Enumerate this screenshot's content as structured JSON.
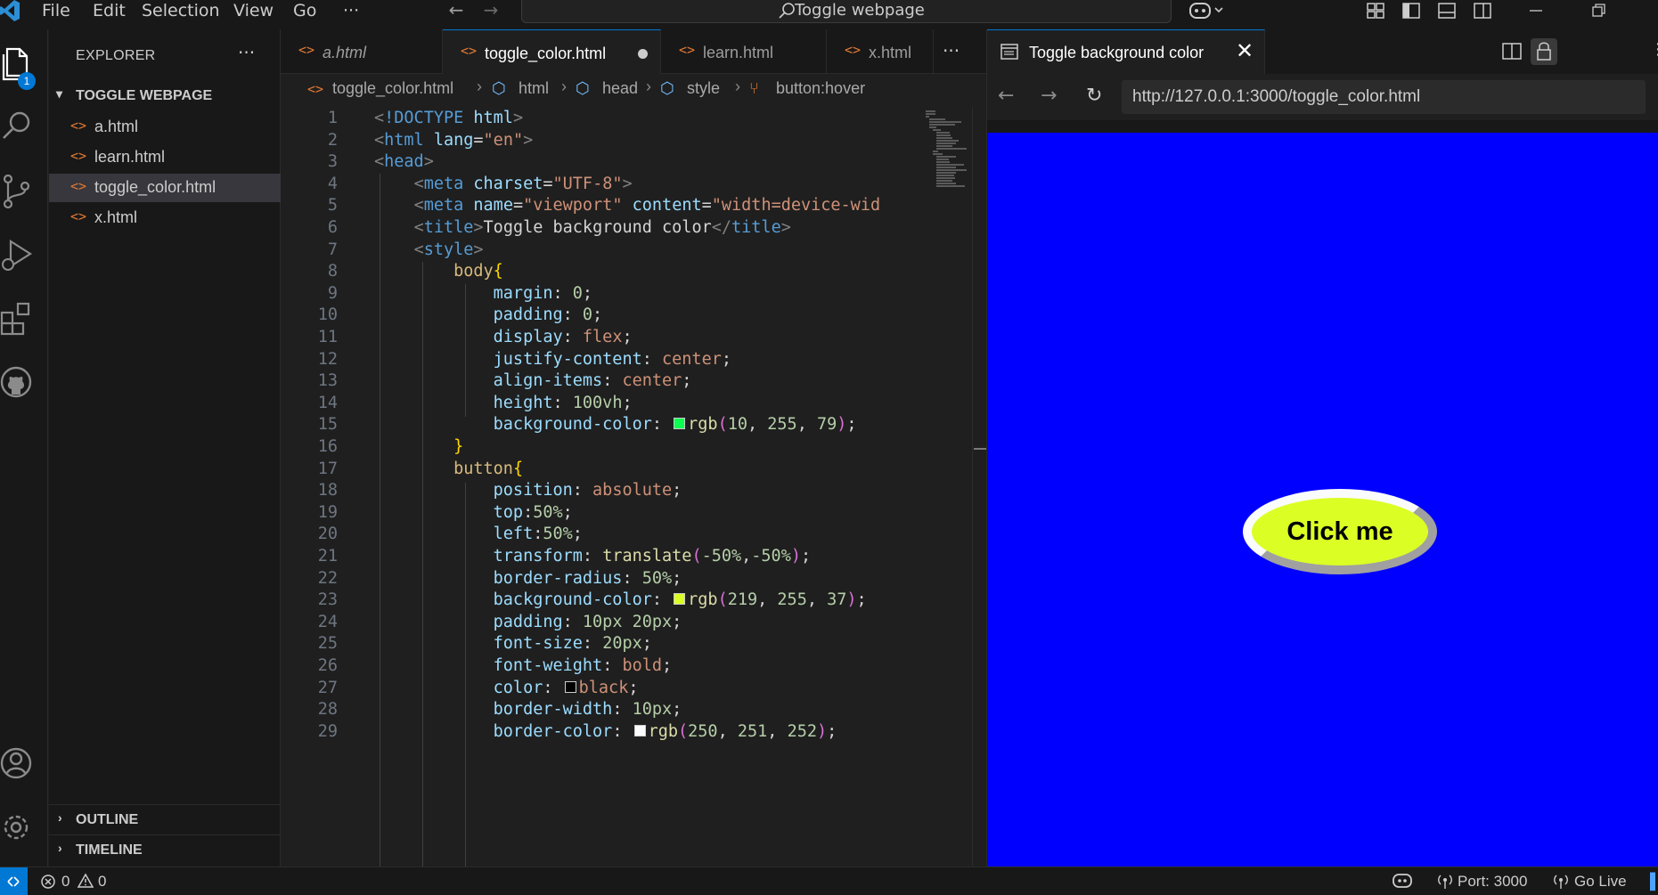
{
  "titlebar": {
    "menu": [
      "File",
      "Edit",
      "Selection",
      "View",
      "Go",
      "···"
    ],
    "search_text": "Toggle webpage",
    "nav_back": "←",
    "nav_forward": "→"
  },
  "activity_bar": {
    "explorer_badge": "1",
    "icons": [
      "files-icon",
      "search-icon",
      "source-control-icon",
      "run-debug-icon",
      "extensions-icon",
      "github-icon",
      "account-icon",
      "settings-gear-icon"
    ]
  },
  "sidebar": {
    "title": "EXPLORER",
    "more": "···",
    "folder": "TOGGLE WEBPAGE",
    "files": [
      {
        "icon": "<>",
        "name": "a.html"
      },
      {
        "icon": "<>",
        "name": "learn.html"
      },
      {
        "icon": "<>",
        "name": "toggle_color.html",
        "active": true
      },
      {
        "icon": "<>",
        "name": "x.html"
      }
    ],
    "sections": [
      "OUTLINE",
      "TIMELINE"
    ]
  },
  "editor": {
    "tabs": [
      {
        "icon": "<>",
        "name": "a.html",
        "preview": true
      },
      {
        "icon": "<>",
        "name": "toggle_color.html",
        "active": true,
        "dirty": true
      },
      {
        "icon": "<>",
        "name": "learn.html"
      },
      {
        "icon": "<>",
        "name": "x.html"
      }
    ],
    "tabs_more": "···",
    "breadcrumb": [
      "toggle_color.html",
      "html",
      "head",
      "style",
      "button:hover"
    ],
    "code_lines": [
      {
        "n": 1,
        "indent": 0,
        "tokens": [
          [
            "t-br",
            "<"
          ],
          [
            "t-tag",
            "!DOCTYPE "
          ],
          [
            "t-attr",
            "html"
          ],
          [
            "t-br",
            ">"
          ]
        ]
      },
      {
        "n": 2,
        "indent": 0,
        "tokens": [
          [
            "t-br",
            "<"
          ],
          [
            "t-tag",
            "html "
          ],
          [
            "t-attr",
            "lang"
          ],
          [
            "t-txt",
            "="
          ],
          [
            "t-str",
            "\"en\""
          ],
          [
            "t-br",
            ">"
          ]
        ]
      },
      {
        "n": 3,
        "indent": 0,
        "tokens": [
          [
            "t-br",
            "<"
          ],
          [
            "t-tag",
            "head"
          ],
          [
            "t-br",
            ">"
          ]
        ]
      },
      {
        "n": 4,
        "indent": 1,
        "tokens": [
          [
            "t-br",
            "<"
          ],
          [
            "t-tag",
            "meta "
          ],
          [
            "t-attr",
            "charset"
          ],
          [
            "t-txt",
            "="
          ],
          [
            "t-str",
            "\"UTF-8\""
          ],
          [
            "t-br",
            ">"
          ]
        ]
      },
      {
        "n": 5,
        "indent": 1,
        "tokens": [
          [
            "t-br",
            "<"
          ],
          [
            "t-tag",
            "meta "
          ],
          [
            "t-attr",
            "name"
          ],
          [
            "t-txt",
            "="
          ],
          [
            "t-str",
            "\"viewport\" "
          ],
          [
            "t-attr",
            "content"
          ],
          [
            "t-txt",
            "="
          ],
          [
            "t-str",
            "\"width=device-wid"
          ]
        ]
      },
      {
        "n": 6,
        "indent": 1,
        "tokens": [
          [
            "t-br",
            "<"
          ],
          [
            "t-tag",
            "title"
          ],
          [
            "t-br",
            ">"
          ],
          [
            "t-txt",
            "Toggle background color"
          ],
          [
            "t-br",
            "</"
          ],
          [
            "t-tag",
            "title"
          ],
          [
            "t-br",
            ">"
          ]
        ]
      },
      {
        "n": 7,
        "indent": 1,
        "tokens": [
          [
            "t-br",
            "<"
          ],
          [
            "t-tag",
            "style"
          ],
          [
            "t-br",
            ">"
          ]
        ]
      },
      {
        "n": 8,
        "indent": 2,
        "tokens": [
          [
            "t-sel",
            "body"
          ],
          [
            "t-brace",
            "{"
          ]
        ]
      },
      {
        "n": 9,
        "indent": 3,
        "tokens": [
          [
            "t-prop",
            "margin"
          ],
          [
            "t-txt",
            ": "
          ],
          [
            "t-num",
            "0"
          ],
          [
            "t-txt",
            ";"
          ]
        ]
      },
      {
        "n": 10,
        "indent": 3,
        "tokens": [
          [
            "t-prop",
            "padding"
          ],
          [
            "t-txt",
            ": "
          ],
          [
            "t-num",
            "0"
          ],
          [
            "t-txt",
            ";"
          ]
        ]
      },
      {
        "n": 11,
        "indent": 3,
        "tokens": [
          [
            "t-prop",
            "display"
          ],
          [
            "t-txt",
            ": "
          ],
          [
            "t-val",
            "flex"
          ],
          [
            "t-txt",
            ";"
          ]
        ]
      },
      {
        "n": 12,
        "indent": 3,
        "tokens": [
          [
            "t-prop",
            "justify-content"
          ],
          [
            "t-txt",
            ": "
          ],
          [
            "t-val",
            "center"
          ],
          [
            "t-txt",
            ";"
          ]
        ]
      },
      {
        "n": 13,
        "indent": 3,
        "tokens": [
          [
            "t-prop",
            "align-items"
          ],
          [
            "t-txt",
            ": "
          ],
          [
            "t-val",
            "center"
          ],
          [
            "t-txt",
            ";"
          ]
        ]
      },
      {
        "n": 14,
        "indent": 3,
        "tokens": [
          [
            "t-prop",
            "height"
          ],
          [
            "t-txt",
            ": "
          ],
          [
            "t-num",
            "100vh"
          ],
          [
            "t-txt",
            ";"
          ]
        ]
      },
      {
        "n": 15,
        "indent": 3,
        "tokens": [
          [
            "t-prop",
            "background-color"
          ],
          [
            "t-txt",
            ": "
          ],
          [
            "swatch",
            "#0aff4f"
          ],
          [
            "t-fn",
            "rgb"
          ],
          [
            "t-par",
            "("
          ],
          [
            "t-num",
            "10"
          ],
          [
            "t-txt",
            ", "
          ],
          [
            "t-num",
            "255"
          ],
          [
            "t-txt",
            ", "
          ],
          [
            "t-num",
            "79"
          ],
          [
            "t-par",
            ")"
          ],
          [
            "t-txt",
            ";"
          ]
        ]
      },
      {
        "n": 16,
        "indent": 2,
        "tokens": [
          [
            "t-brace",
            "}"
          ]
        ]
      },
      {
        "n": 17,
        "indent": 2,
        "tokens": [
          [
            "t-sel",
            "button"
          ],
          [
            "t-brace",
            "{"
          ]
        ]
      },
      {
        "n": 18,
        "indent": 3,
        "tokens": [
          [
            "t-prop",
            "position"
          ],
          [
            "t-txt",
            ": "
          ],
          [
            "t-val",
            "absolute"
          ],
          [
            "t-txt",
            ";"
          ]
        ]
      },
      {
        "n": 19,
        "indent": 3,
        "tokens": [
          [
            "t-prop",
            "top"
          ],
          [
            "t-txt",
            ":"
          ],
          [
            "t-num",
            "50%"
          ],
          [
            "t-txt",
            ";"
          ]
        ]
      },
      {
        "n": 20,
        "indent": 3,
        "tokens": [
          [
            "t-prop",
            "left"
          ],
          [
            "t-txt",
            ":"
          ],
          [
            "t-num",
            "50%"
          ],
          [
            "t-txt",
            ";"
          ]
        ]
      },
      {
        "n": 21,
        "indent": 3,
        "tokens": [
          [
            "t-prop",
            "transform"
          ],
          [
            "t-txt",
            ": "
          ],
          [
            "t-fn",
            "translate"
          ],
          [
            "t-par",
            "("
          ],
          [
            "t-num",
            "-50%"
          ],
          [
            "t-txt",
            ","
          ],
          [
            "t-num",
            "-50%"
          ],
          [
            "t-par",
            ")"
          ],
          [
            "t-txt",
            ";"
          ]
        ]
      },
      {
        "n": 22,
        "indent": 3,
        "tokens": [
          [
            "t-prop",
            "border-radius"
          ],
          [
            "t-txt",
            ": "
          ],
          [
            "t-num",
            "50%"
          ],
          [
            "t-txt",
            ";"
          ]
        ]
      },
      {
        "n": 23,
        "indent": 3,
        "tokens": [
          [
            "t-prop",
            "background-color"
          ],
          [
            "t-txt",
            ": "
          ],
          [
            "swatch",
            "#dbff25"
          ],
          [
            "t-fn",
            "rgb"
          ],
          [
            "t-par",
            "("
          ],
          [
            "t-num",
            "219"
          ],
          [
            "t-txt",
            ", "
          ],
          [
            "t-num",
            "255"
          ],
          [
            "t-txt",
            ", "
          ],
          [
            "t-num",
            "37"
          ],
          [
            "t-par",
            ")"
          ],
          [
            "t-txt",
            ";"
          ]
        ]
      },
      {
        "n": 24,
        "indent": 3,
        "tokens": [
          [
            "t-prop",
            "padding"
          ],
          [
            "t-txt",
            ": "
          ],
          [
            "t-num",
            "10px 20px"
          ],
          [
            "t-txt",
            ";"
          ]
        ]
      },
      {
        "n": 25,
        "indent": 3,
        "tokens": [
          [
            "t-prop",
            "font-size"
          ],
          [
            "t-txt",
            ": "
          ],
          [
            "t-num",
            "20px"
          ],
          [
            "t-txt",
            ";"
          ]
        ]
      },
      {
        "n": 26,
        "indent": 3,
        "tokens": [
          [
            "t-prop",
            "font-weight"
          ],
          [
            "t-txt",
            ": "
          ],
          [
            "t-val",
            "bold"
          ],
          [
            "t-txt",
            ";"
          ]
        ]
      },
      {
        "n": 27,
        "indent": 3,
        "tokens": [
          [
            "t-prop",
            "color"
          ],
          [
            "t-txt",
            ": "
          ],
          [
            "swatch",
            "#000000"
          ],
          [
            "t-val",
            "black"
          ],
          [
            "t-txt",
            ";"
          ]
        ]
      },
      {
        "n": 28,
        "indent": 3,
        "tokens": [
          [
            "t-prop",
            "border-width"
          ],
          [
            "t-txt",
            ": "
          ],
          [
            "t-num",
            "10px"
          ],
          [
            "t-txt",
            ";"
          ]
        ]
      },
      {
        "n": 29,
        "indent": 3,
        "tokens": [
          [
            "t-prop",
            "border-color"
          ],
          [
            "t-txt",
            ": "
          ],
          [
            "swatch",
            "#fafbfc"
          ],
          [
            "t-fn",
            "rgb"
          ],
          [
            "t-par",
            "("
          ],
          [
            "t-num",
            "250"
          ],
          [
            "t-txt",
            ", "
          ],
          [
            "t-num",
            "251"
          ],
          [
            "t-txt",
            ", "
          ],
          [
            "t-num",
            "252"
          ],
          [
            "t-par",
            ")"
          ],
          [
            "t-txt",
            ";"
          ]
        ]
      }
    ]
  },
  "browser": {
    "tab_title": "Toggle background color",
    "close": "✕",
    "back": "←",
    "forward": "→",
    "reload": "↻",
    "url": "http://127.0.0.1:3000/toggle_color.html",
    "page_bg": "#0000ff",
    "button_label": "Click me",
    "button_bg": "#dbff25"
  },
  "statusbar": {
    "errors": "0",
    "warnings": "0",
    "port": "Port: 3000",
    "go_live": "Go Live"
  }
}
